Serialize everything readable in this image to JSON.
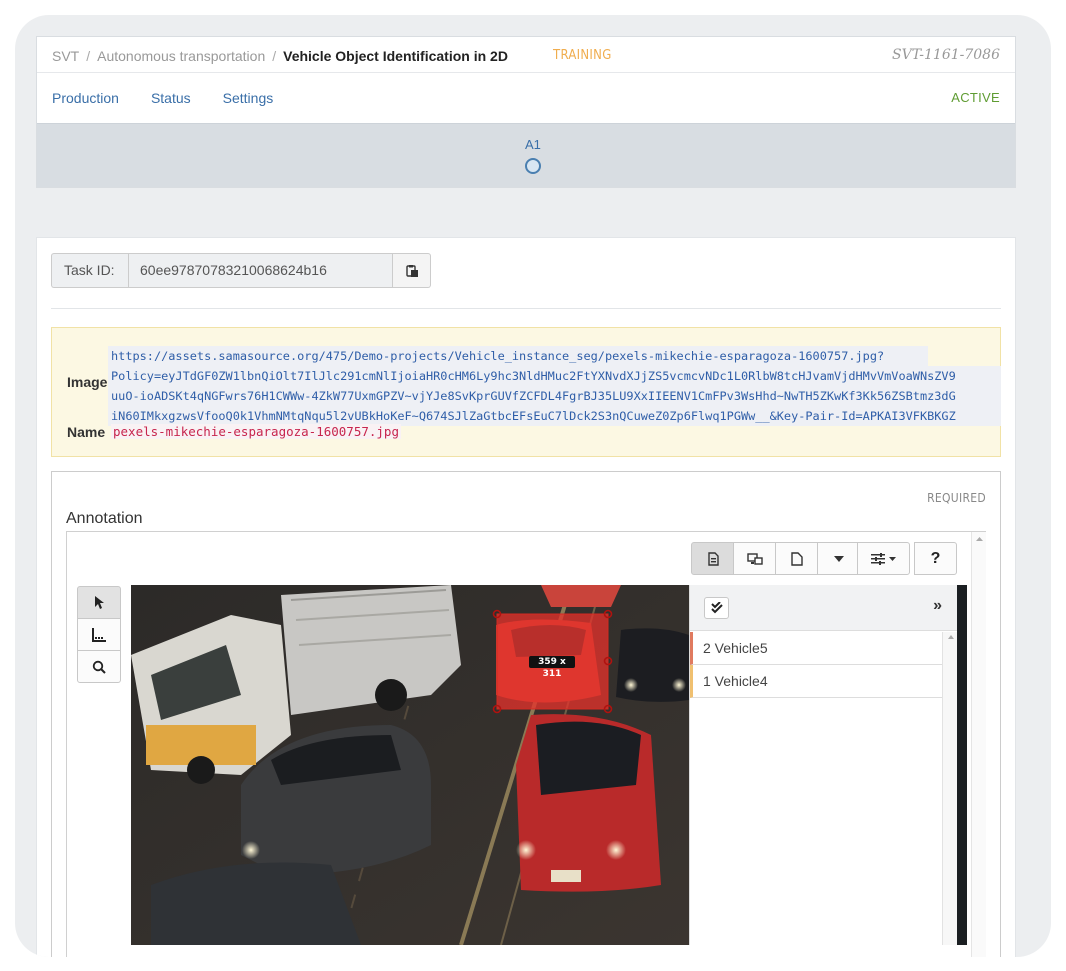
{
  "breadcrumb": {
    "root": "SVT",
    "project": "Autonomous transportation",
    "current": "Vehicle Object Identification in 2D"
  },
  "header": {
    "status_badge": "TRAINING",
    "task_code": "SVT-1161-7086",
    "state": "ACTIVE"
  },
  "nav": {
    "items": [
      "Production",
      "Status",
      "Settings"
    ]
  },
  "workflow": {
    "step": "A1"
  },
  "task": {
    "label": "Task ID:",
    "id": "60ee97870783210068624b16"
  },
  "metadata": {
    "image_label": "Image",
    "name_label": "Name",
    "image_url_lines": [
      "https://assets.samasource.org/475/Demo-projects/Vehicle_instance_seg/pexels-mikechie-esparagoza-1600757.jpg?",
      "Policy=eyJTdGF0ZW1lbnQiOlt7IlJlc291cmNlIjoiaHR0cHM6Ly9hc3NldHMuc2FtYXNvdXJjZS5vcmcvNDc1L0RlbW8tcHJvamVjdHMvVmVoaWNsZV9",
      "uuO-ioADSKt4qNGFwrs76H1CWWw-4ZkW77UxmGPZV~vjYJe8SvKprGUVfZCFDL4FgrBJ35LU9XxIIEENV1CmFPv3WsHhd~NwTH5ZKwKf3Kk56ZSBtmz3dG",
      "iN60IMkxgzwsVfooQ0k1VhmNMtqNqu5l2vUBkHoKeF~Q674SJlZaGtbcEFsEuC7lDck2S3nQCuweZ0Zp6Flwq1PGWw__&Key-Pair-Id=APKAI3VFKBKGZ"
    ],
    "name_value": "pexels-mikechie-esparagoza-1600757.jpg"
  },
  "annotation": {
    "required_label": "REQUIRED",
    "title": "Annotation",
    "box_size_label": "359 x 311",
    "objects": [
      {
        "label": "2 Vehicle5",
        "color": "#e07a5f"
      },
      {
        "label": "1 Vehicle4",
        "color": "#f0c070"
      }
    ]
  },
  "icons": {
    "toolbar": [
      "document-check-icon",
      "screens-icon",
      "file-icon",
      "caret-down-icon",
      "sliders-icon",
      "help-icon"
    ],
    "tools": [
      "pointer-icon",
      "measure-icon",
      "magnifier-icon"
    ]
  },
  "colors": {
    "accent": "#3a6fa8",
    "training": "#f0ad4e",
    "active": "#5f9c32",
    "box": "#e8322b"
  }
}
